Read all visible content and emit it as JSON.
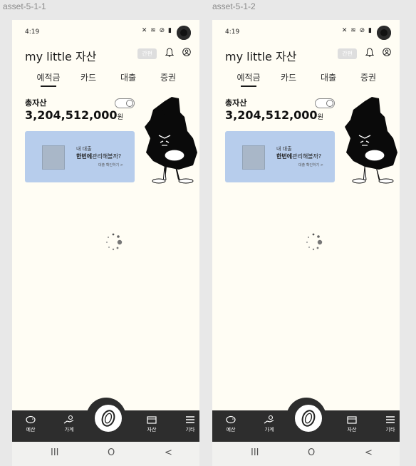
{
  "frames": [
    {
      "label": "asset-5-1-1",
      "status": {
        "time": "4:19",
        "icons": "✕ ≋ ⊘ ▮"
      },
      "appbar": {
        "title": "my little 자산",
        "simple_badge": "간편"
      },
      "tabs": [
        {
          "label": "예적금",
          "active": true
        },
        {
          "label": "카드",
          "active": false
        },
        {
          "label": "대출",
          "active": false
        },
        {
          "label": "증권",
          "active": false
        }
      ],
      "total": {
        "label": "총자산",
        "value": "3,204,512,000",
        "unit": "원"
      },
      "banner": {
        "line1": "내 대출",
        "line2_bold": "한번에",
        "line2_rest": "관리해볼까?",
        "link": "대출 확인하기 >"
      },
      "bottom_nav": [
        {
          "label": "예산",
          "icon": "piggy-bank-icon"
        },
        {
          "label": "가계",
          "icon": "hand-coin-icon"
        },
        {
          "label": "자산",
          "icon": "wallet-icon"
        },
        {
          "label": "기타",
          "icon": "menu-icon"
        }
      ],
      "center_icon": "coin-icon",
      "system_nav": {
        "recent": "III",
        "home": "O",
        "back": "<"
      }
    },
    {
      "label": "asset-5-1-2",
      "status": {
        "time": "4:19",
        "icons": "✕ ≋ ⊘ ▮"
      },
      "appbar": {
        "title": "my little 자산",
        "simple_badge": "간편"
      },
      "tabs": [
        {
          "label": "예적금",
          "active": true
        },
        {
          "label": "카드",
          "active": false
        },
        {
          "label": "대출",
          "active": false
        },
        {
          "label": "증권",
          "active": false
        }
      ],
      "total": {
        "label": "총자산",
        "value": "3,204,512,000",
        "unit": "원"
      },
      "banner": {
        "line1": "내 대출",
        "line2_bold": "한번에",
        "line2_rest": "관리해볼까?",
        "link": "대출 확인하기 >"
      },
      "bottom_nav": [
        {
          "label": "예산",
          "icon": "piggy-bank-icon"
        },
        {
          "label": "가계",
          "icon": "hand-coin-icon"
        },
        {
          "label": "자산",
          "icon": "wallet-icon"
        },
        {
          "label": "기타",
          "icon": "menu-icon"
        }
      ],
      "center_icon": "coin-icon",
      "system_nav": {
        "recent": "III",
        "home": "O",
        "back": "<"
      }
    }
  ],
  "colors": {
    "screen_bg": "#fffdf4",
    "banner_bg": "#b7cdec",
    "nav_bg": "#2d2d2d"
  }
}
